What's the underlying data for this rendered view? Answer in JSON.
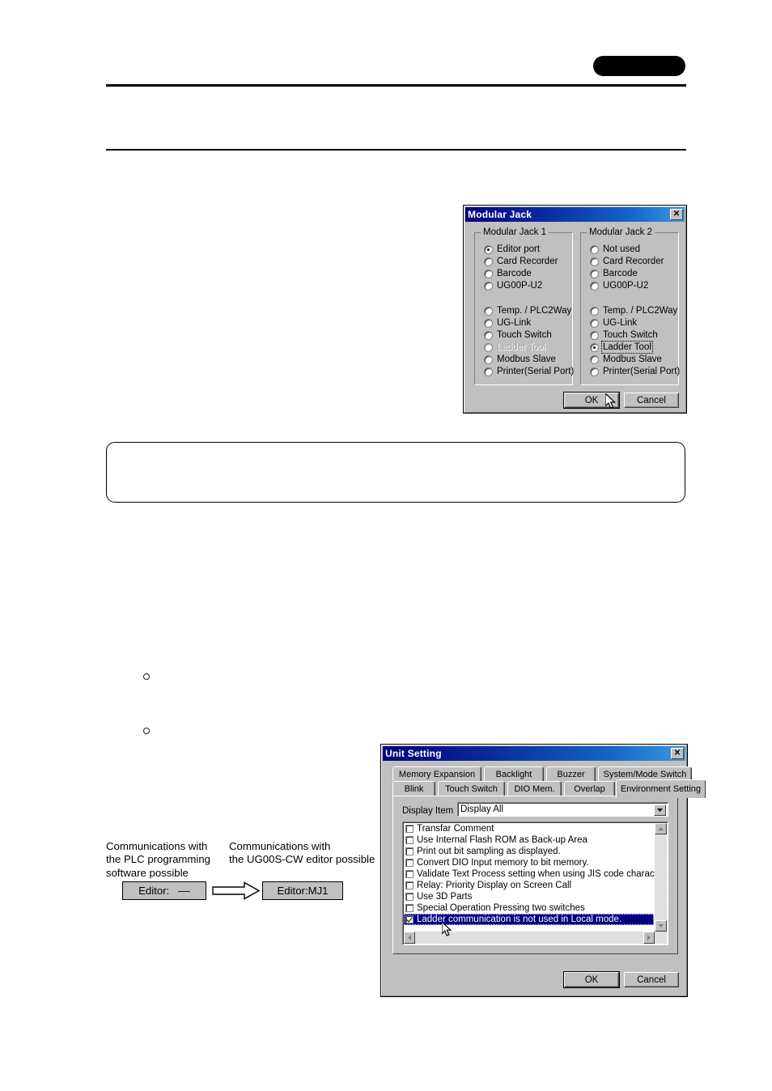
{
  "page": {
    "badge": "",
    "note_box_text": ""
  },
  "diagram": {
    "caption_left": "Communications with\nthe PLC programming\nsoftware possible",
    "caption_right": "Communications with\nthe UG00S-CW editor possible",
    "chip_left": "Editor:   ––",
    "chip_right": "Editor:MJ1",
    "arrow_icon": "right-arrow-icon"
  },
  "modular_jack_dialog": {
    "title": "Modular Jack",
    "close_label": "✕",
    "group1": {
      "label": "Modular Jack 1",
      "options": [
        {
          "label": "Editor port",
          "checked": true,
          "disabled": false
        },
        {
          "label": "Card Recorder",
          "checked": false,
          "disabled": false
        },
        {
          "label": "Barcode",
          "checked": false,
          "disabled": false
        },
        {
          "label": "UG00P-U2",
          "checked": false,
          "disabled": false
        },
        {
          "label": "Temp. / PLC2Way",
          "checked": false,
          "disabled": false
        },
        {
          "label": "UG-Link",
          "checked": false,
          "disabled": false
        },
        {
          "label": "Touch Switch",
          "checked": false,
          "disabled": false
        },
        {
          "label": "Ladder Tool",
          "checked": false,
          "disabled": true
        },
        {
          "label": "Modbus Slave",
          "checked": false,
          "disabled": false
        },
        {
          "label": "Printer(Serial Port)",
          "checked": false,
          "disabled": false
        }
      ]
    },
    "group2": {
      "label": "Modular Jack 2",
      "options": [
        {
          "label": "Not used",
          "checked": false,
          "disabled": false
        },
        {
          "label": "Card Recorder",
          "checked": false,
          "disabled": false
        },
        {
          "label": "Barcode",
          "checked": false,
          "disabled": false
        },
        {
          "label": "UG00P-U2",
          "checked": false,
          "disabled": false
        },
        {
          "label": "Temp. / PLC2Way",
          "checked": false,
          "disabled": false
        },
        {
          "label": "UG-Link",
          "checked": false,
          "disabled": false
        },
        {
          "label": "Touch Switch",
          "checked": false,
          "disabled": false
        },
        {
          "label": "Ladder Tool",
          "checked": true,
          "disabled": false,
          "focused": true
        },
        {
          "label": "Modbus Slave",
          "checked": false,
          "disabled": false
        },
        {
          "label": "Printer(Serial Port)",
          "checked": false,
          "disabled": false
        }
      ]
    },
    "ok_label": "OK",
    "cancel_label": "Cancel"
  },
  "unit_setting_dialog": {
    "title": "Unit Setting",
    "close_label": "✕",
    "tabs_row1": [
      {
        "label": "Memory Expansion",
        "active": false
      },
      {
        "label": "Backlight",
        "active": false
      },
      {
        "label": "Buzzer",
        "active": false
      },
      {
        "label": "System/Mode Switch",
        "active": false
      }
    ],
    "tabs_row2": [
      {
        "label": "Blink",
        "active": false
      },
      {
        "label": "Touch Switch",
        "active": false
      },
      {
        "label": "DIO Mem.",
        "active": false
      },
      {
        "label": "Overlap",
        "active": false
      },
      {
        "label": "Environment Setting",
        "active": true
      }
    ],
    "display_item_label": "Display Item",
    "display_item_value": "Display All",
    "checklist": [
      {
        "label": "Transfar Comment",
        "checked": false,
        "selected": false
      },
      {
        "label": "Use Internal Flash ROM as Back-up Area",
        "checked": false,
        "selected": false
      },
      {
        "label": "Print out bit sampling as displayed.",
        "checked": false,
        "selected": false
      },
      {
        "label": "Convert DIO Input memory to bit memory.",
        "checked": false,
        "selected": false
      },
      {
        "label": "Validate Text Process setting when using JIS code character strings.",
        "checked": false,
        "selected": false
      },
      {
        "label": "Relay: Priority Display on Screen Call",
        "checked": false,
        "selected": false
      },
      {
        "label": "Use 3D Parts",
        "checked": false,
        "selected": false
      },
      {
        "label": "Special Operation Pressing two switches",
        "checked": false,
        "selected": false
      },
      {
        "label": "Ladder communication is not used in Local mode.",
        "checked": true,
        "selected": true
      }
    ],
    "ok_label": "OK",
    "cancel_label": "Cancel",
    "scroll_up_icon": "triangle-up-icon",
    "scroll_down_icon": "triangle-down-icon",
    "scroll_left_icon": "triangle-left-icon",
    "scroll_right_icon": "triangle-right-icon"
  },
  "colors": {
    "dialog_face": "#c0c0c0",
    "titlebar_start": "#00007b",
    "titlebar_end": "#3a9ae0",
    "selection": "#000080",
    "chip_fill": "#c0c0c0"
  }
}
